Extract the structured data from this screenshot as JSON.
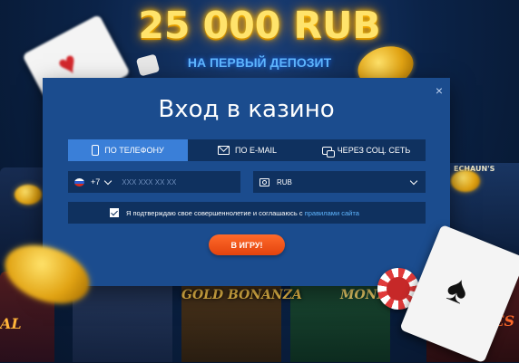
{
  "banner": {
    "amount": "25 000 RUB",
    "subtitle": "НА ПЕРВЫЙ ДЕПОЗИТ"
  },
  "modal": {
    "title": "Вход в казино",
    "close_icon": "×",
    "tabs": [
      {
        "label": "ПО ТЕЛЕФОНУ",
        "icon": "phone-icon",
        "active": true
      },
      {
        "label": "ПО E-MAIL",
        "icon": "mail-icon",
        "active": false
      },
      {
        "label": "ЧЕРЕЗ СОЦ. СЕТЬ",
        "icon": "chat-icon",
        "active": false
      }
    ],
    "phone": {
      "country_code": "+7",
      "placeholder": "XXX XXX XX XX"
    },
    "currency": {
      "selected": "RUB"
    },
    "agreement": {
      "checked": true,
      "text": "Я подтверждаю свое совершеннолетие и соглашаюсь с",
      "link": "правилами сайта"
    },
    "submit_label": "В ИГРУ!"
  },
  "background": {
    "tile_labels": {
      "gold_bonanza": "GOLD BONANZA",
      "monkey": "MONKI",
      "res": "RES",
      "al": "AL",
      "leprechaun": "ECHAUN'S"
    }
  },
  "colors": {
    "modal_bg": "#1b4c8e",
    "field_bg": "#0f315f",
    "tab_active": "#3a7fd8",
    "accent_orange": "#e3430e",
    "banner_gold": "#ffe36b",
    "link_blue": "#5fb6ff"
  }
}
